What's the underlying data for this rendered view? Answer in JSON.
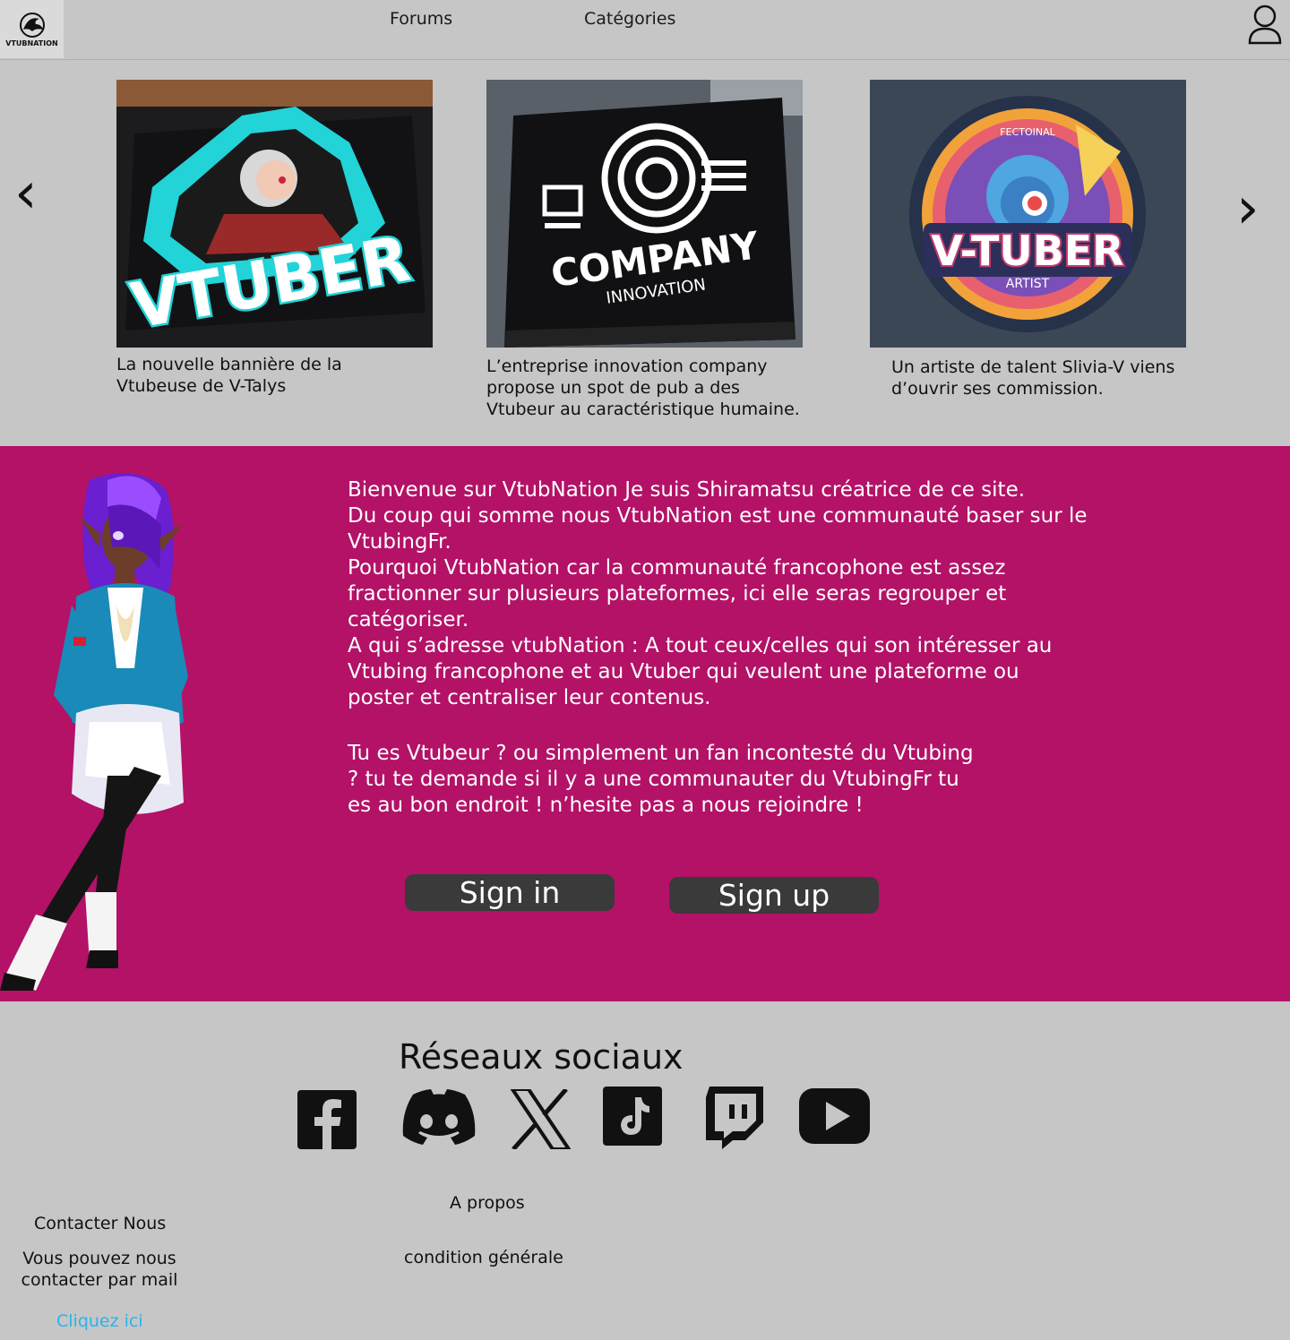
{
  "header": {
    "logo_text": "VTUBNATION",
    "nav": [
      {
        "label": "Forums"
      },
      {
        "label": "Catégories"
      }
    ]
  },
  "carousel": {
    "prev_glyph": "‹",
    "next_glyph": "›",
    "cards": [
      {
        "image_text": "VTUBER",
        "caption": "La nouvelle bannière de la\nVtubeuse de V-Talys"
      },
      {
        "image_text": "COMPANY",
        "image_subtext": "INNOVATION",
        "caption": "L’entreprise innovation company propose un spot de pub a des Vtubeur au caractéristique humaine."
      },
      {
        "image_text": "V-TUBER",
        "image_subtext": "ARTIST",
        "image_toptext": "FECTOINAL",
        "caption": "Un artiste de talent Slivia-V viens d’ouvrir ses commission."
      }
    ]
  },
  "intro": {
    "paragraph1": "Bienvenue sur VtubNation Je suis Shiramatsu créatrice de ce site.\nDu coup qui somme nous VtubNation est une communauté baser sur le VtubingFr.\nPourquoi VtubNation car la communauté francophone est assez fractionner sur plusieurs plateformes, ici elle seras regrouper et catégoriser.\nA qui s’adresse vtubNation : A tout ceux/celles qui son intéresser au Vtubing francophone et au Vtuber qui veulent une plateforme ou poster et centraliser leur contenus.",
    "paragraph2": "Tu es Vtubeur ? ou simplement un fan incontesté du Vtubing\n? tu te demande si il y a une communauter du VtubingFr tu\nes au bon endroit ! n’hesite pas a nous rejoindre !",
    "sign_in": "Sign in",
    "sign_up": "Sign up",
    "accent_color": "#b31267"
  },
  "footer": {
    "social_title": "Réseaux sociaux",
    "socials": [
      "facebook-icon",
      "discord-icon",
      "x-icon",
      "tiktok-icon",
      "twitch-icon",
      "youtube-icon"
    ],
    "about": "A propos",
    "conditions": "condition générale",
    "contact_title": "Contacter Nous",
    "contact_text": "Vous pouvez nous contacter par mail",
    "contact_link": "Cliquez ici",
    "link_color": "#29b4ea"
  }
}
